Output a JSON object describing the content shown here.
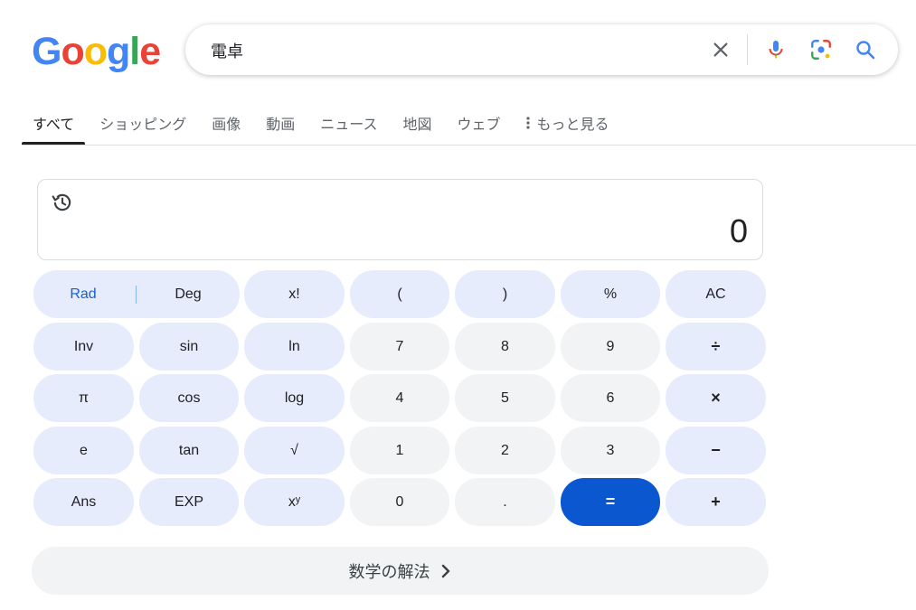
{
  "logo": {
    "letters": [
      "G",
      "o",
      "o",
      "g",
      "l",
      "e"
    ],
    "colors": [
      "#4285f4",
      "#ea4335",
      "#fbbc05",
      "#4285f4",
      "#34a853",
      "#ea4335"
    ]
  },
  "search": {
    "query": "電卓"
  },
  "tabs": [
    "すべて",
    "ショッピング",
    "画像",
    "動画",
    "ニュース",
    "地図",
    "ウェブ",
    "もっと見る"
  ],
  "calculator": {
    "display": "0",
    "mode_rad": "Rad",
    "mode_deg": "Deg",
    "keys": {
      "factorial": "x!",
      "lparen": "(",
      "rparen": ")",
      "percent": "%",
      "clear": "AC",
      "inv": "Inv",
      "sin": "sin",
      "ln": "ln",
      "seven": "7",
      "eight": "8",
      "nine": "9",
      "divide": "÷",
      "pi": "π",
      "cos": "cos",
      "log": "log",
      "four": "4",
      "five": "5",
      "six": "6",
      "multiply": "×",
      "e": "e",
      "tan": "tan",
      "sqrt": "√",
      "one": "1",
      "two": "2",
      "three": "3",
      "minus": "−",
      "ans": "Ans",
      "exp": "EXP",
      "power": "xʸ",
      "zero": "0",
      "dot": ".",
      "equals": "=",
      "plus": "+"
    },
    "solve_label": "数学の解法"
  },
  "colors": {
    "accent": "#0b57d0",
    "key_blue": "#e6ecfb",
    "key_gray": "#f1f3f4"
  }
}
